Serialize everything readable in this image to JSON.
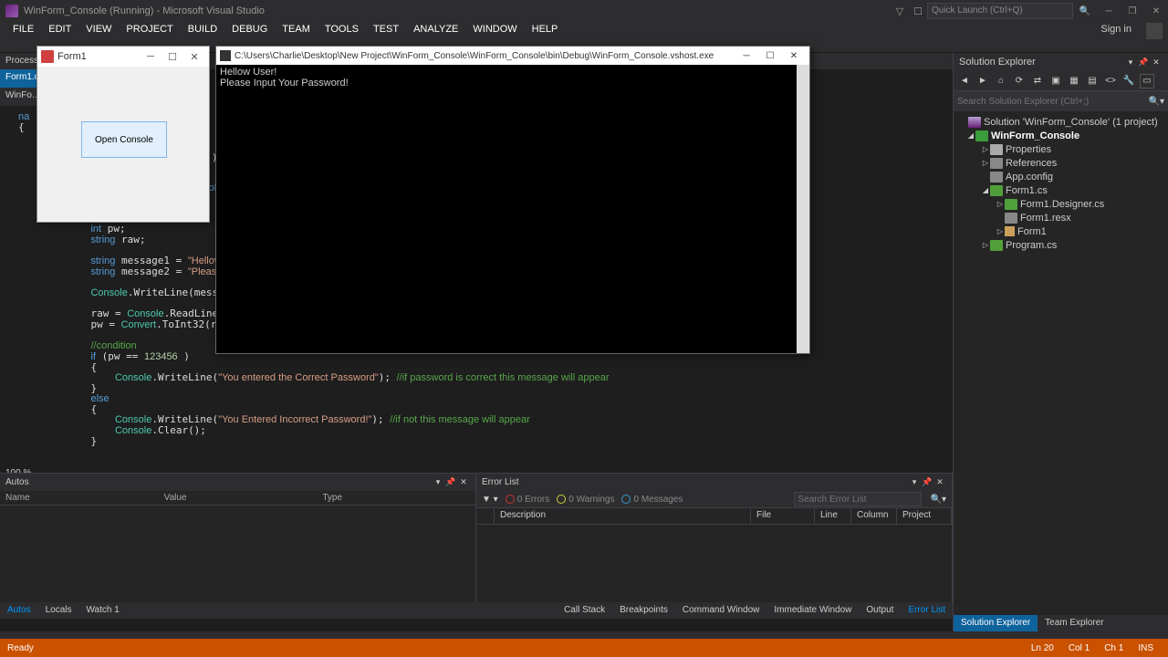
{
  "title": "WinForm_Console (Running) - Microsoft Visual Studio",
  "quick_launch_placeholder": "Quick Launch (Ctrl+Q)",
  "sign_in": "Sign in",
  "menu": [
    "FILE",
    "EDIT",
    "VIEW",
    "PROJECT",
    "BUILD",
    "DEBUG",
    "TEAM",
    "TOOLS",
    "TEST",
    "ANALYZE",
    "WINDOW",
    "HELP"
  ],
  "process_label": "Process:",
  "doc_tabs": [
    "Form1.cs",
    "WinFo…"
  ],
  "zoom": "100 %",
  "winform": {
    "title": "Form1",
    "button": "Open Console"
  },
  "console": {
    "path": "C:\\Users\\Charlie\\Desktop\\New Project\\WinForm_Console\\WinForm_Console\\bin\\Debug\\WinForm_Console.vshost.exe",
    "line1": "Hellow User!",
    "line2": "Please Input Your Password!"
  },
  "autos": {
    "title": "Autos",
    "cols": [
      "Name",
      "Value",
      "Type"
    ]
  },
  "errorlist": {
    "title": "Error List",
    "errors": "0 Errors",
    "warnings": "0 Warnings",
    "messages": "0 Messages",
    "search_ph": "Search Error List",
    "cols": {
      "desc": "Description",
      "file": "File",
      "line": "Line",
      "col": "Column",
      "proj": "Project"
    }
  },
  "bottom_tabs_left": [
    "Autos",
    "Locals",
    "Watch 1"
  ],
  "bottom_tabs_right": [
    "Call Stack",
    "Breakpoints",
    "Command Window",
    "Immediate Window",
    "Output",
    "Error List"
  ],
  "side_tabs": [
    "Solution Explorer",
    "Team Explorer"
  ],
  "se": {
    "title": "Solution Explorer",
    "search_ph": "Search Solution Explorer (Ctrl+;)",
    "solution": "Solution 'WinForm_Console' (1 project)",
    "project": "WinForm_Console",
    "properties": "Properties",
    "references": "References",
    "appconfig": "App.config",
    "form1cs": "Form1.cs",
    "designer": "Form1.Designer.cs",
    "resx": "Form1.resx",
    "form1": "Form1",
    "program": "Program.cs"
  },
  "status": {
    "ready": "Ready",
    "ln": "Ln 20",
    "col": "Col 1",
    "ch": "Ch 1",
    "ins": "INS"
  }
}
